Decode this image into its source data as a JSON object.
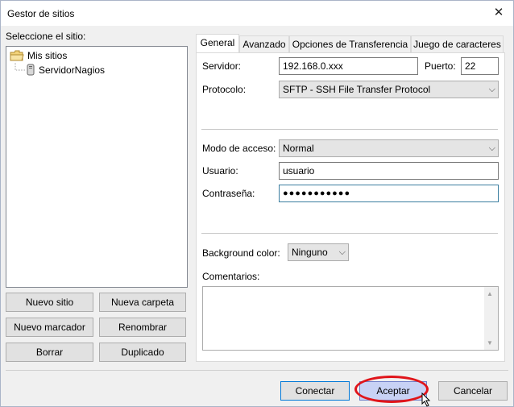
{
  "window": {
    "title": "Gestor de sitios"
  },
  "left": {
    "select_label": "Seleccione el sitio:",
    "tree": [
      {
        "label": "Mis sitios",
        "icon": "folder-icon"
      },
      {
        "label": "ServidorNagios",
        "icon": "server-icon"
      }
    ],
    "buttons": {
      "new_site": "Nuevo sitio",
      "new_folder": "Nueva carpeta",
      "new_bookmark": "Nuevo marcador",
      "rename": "Renombrar",
      "delete": "Borrar",
      "duplicate": "Duplicado"
    }
  },
  "tabs": [
    "General",
    "Avanzado",
    "Opciones de Transferencia",
    "Juego de caracteres"
  ],
  "general": {
    "server_label": "Servidor:",
    "server_value": "192.168.0.xxx",
    "port_label": "Puerto:",
    "port_value": "22",
    "protocol_label": "Protocolo:",
    "protocol_value": "SFTP - SSH File Transfer Protocol",
    "access_label": "Modo de acceso:",
    "access_value": "Normal",
    "user_label": "Usuario:",
    "user_value": "usuario",
    "password_label": "Contraseña:",
    "password_value": "●●●●●●●●●●●",
    "bg_color_label": "Background color:",
    "bg_color_value": "Ninguno",
    "comments_label": "Comentarios:"
  },
  "footer": {
    "connect": "Conectar",
    "accept": "Aceptar",
    "cancel": "Cancelar"
  },
  "colors": {
    "highlight": "#e0141a",
    "accept_bg": "#c8d2f5",
    "focus_border": "#3a7d9f"
  }
}
